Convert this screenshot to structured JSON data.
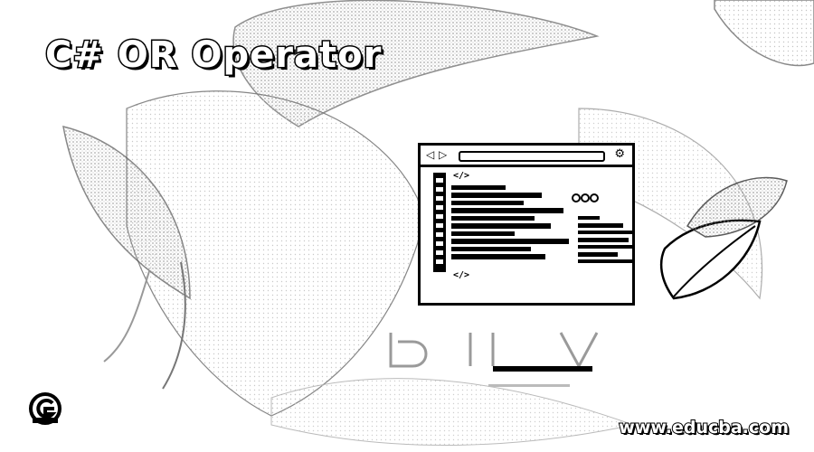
{
  "title": "C# OR Operator",
  "footer": {
    "site_url": "www.educba.com"
  },
  "icons": {
    "logo": "educba-logo-icon",
    "window_back": "chevron-left-icon",
    "window_forward": "play-icon",
    "window_settings": "gear-icon"
  },
  "window_glyphs": {
    "back": "◁",
    "forward": "▷",
    "settings": "⚙"
  },
  "colors": {
    "background": "#ffffff",
    "ink": "#000000",
    "stipple": "#b9b9b9"
  }
}
